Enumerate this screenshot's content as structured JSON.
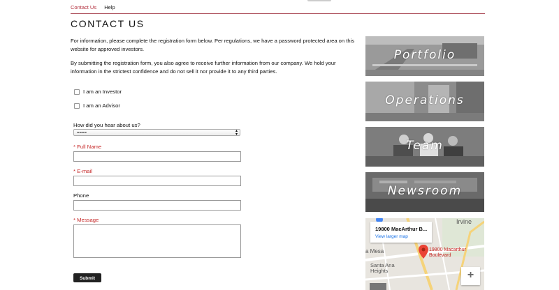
{
  "nav": {
    "contact_label": "Contact Us",
    "help_label": "Help"
  },
  "page": {
    "title": "CONTACT US"
  },
  "intro": {
    "p1": "For information, please complete the registration form below. Per regulations, we have a password protected area on this website for approved investors.",
    "p2": "By submitting the registration form, you also agree to receive further information from our company. We hold your information in the strictest confidence and do not sell it nor provide it to any third parties."
  },
  "form": {
    "investor_label": "I am an Investor",
    "advisor_label": "I am an Advisor",
    "how_label": "How did you hear about us?",
    "how_selected": "====",
    "fullname_label": "Full Name",
    "email_label": "E-mail",
    "phone_label": "Phone",
    "message_label": "Message",
    "required_mark": "* ",
    "submit_label": "Submit"
  },
  "tiles": [
    {
      "label": "Portfolio"
    },
    {
      "label": "Operations"
    },
    {
      "label": "Team"
    },
    {
      "label": "Newsroom"
    }
  ],
  "map": {
    "place_name": "19800 MacArthur B...",
    "larger_map": "View larger map",
    "pin_label_1": "19800 Macarthur",
    "pin_label_2": "Boulevard",
    "irvine": "Irvine",
    "costa_mesa": "a Mesa",
    "santa_ana_1": "Santa Ana",
    "santa_ana_2": "Heights",
    "zoom_in": "+"
  },
  "colors": {
    "accent": "#b3313f",
    "required": "#c62828",
    "link": "#1a73e8"
  }
}
